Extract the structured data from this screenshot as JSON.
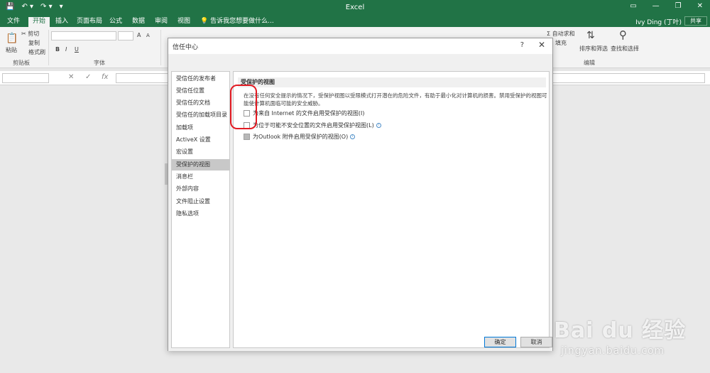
{
  "titlebar": {
    "title": "Excel",
    "qat": [
      "💾",
      "↶ ▾",
      "↷ ▾",
      "▾"
    ],
    "controls": [
      "▭",
      "—",
      "❐",
      "✕"
    ]
  },
  "tabs": [
    "文件",
    "开始",
    "插入",
    "页面布局",
    "公式",
    "数据",
    "审阅",
    "视图"
  ],
  "active_tab": "开始",
  "tell_me": "告诉我您想要做什么...",
  "user": "Ivy Ding (丁叶)",
  "share": "共享",
  "ribbon": {
    "paste": "粘贴",
    "cut": "✂ 剪切",
    "copy": "复制",
    "format_painter": "格式刷",
    "clipboard_group": "剪贴板",
    "font_group": "字体",
    "bold": "B",
    "italic": "I",
    "underline": "U",
    "autosum": "Σ 自动求和",
    "fill": "填充",
    "sort_filter": "排序和筛选",
    "find_select": "查找和选择",
    "edit_group": "编辑",
    "font_grow": "A",
    "font_shrink": "A"
  },
  "formula": {
    "fx": "fx",
    "cancel": "✕",
    "enter": "✓"
  },
  "dialog": {
    "title": "信任中心",
    "help": "?",
    "close": "✕",
    "nav_items": [
      "受信任的发布者",
      "受信任位置",
      "受信任的文档",
      "受信任的加载项目录",
      "加载项",
      "ActiveX 设置",
      "宏设置",
      "受保护的视图",
      "消息栏",
      "外部内容",
      "文件阻止设置",
      "隐私选项"
    ],
    "selected_nav": "受保护的视图",
    "section_title": "受保护的视图",
    "description": "在没有任何安全提示的情况下，受保护视图以受限模式打开潜在的危险文件，有助于最小化对计算机的损害。禁用受保护的视图可能使计算机面临可能的安全威胁。",
    "options": [
      {
        "label": "为来自 Internet 的文件启用受保护的视图(I)",
        "info": false
      },
      {
        "label": "为位于可能不安全位置的文件启用受保护视图(L)",
        "info": true
      },
      {
        "label": "为Outlook 附件启用受保护的视图(O)",
        "info": true
      }
    ],
    "ok": "确定",
    "cancel": "取消"
  },
  "watermark": {
    "main": "Bai du 经验",
    "sub": "jingyan.baidu.com"
  }
}
